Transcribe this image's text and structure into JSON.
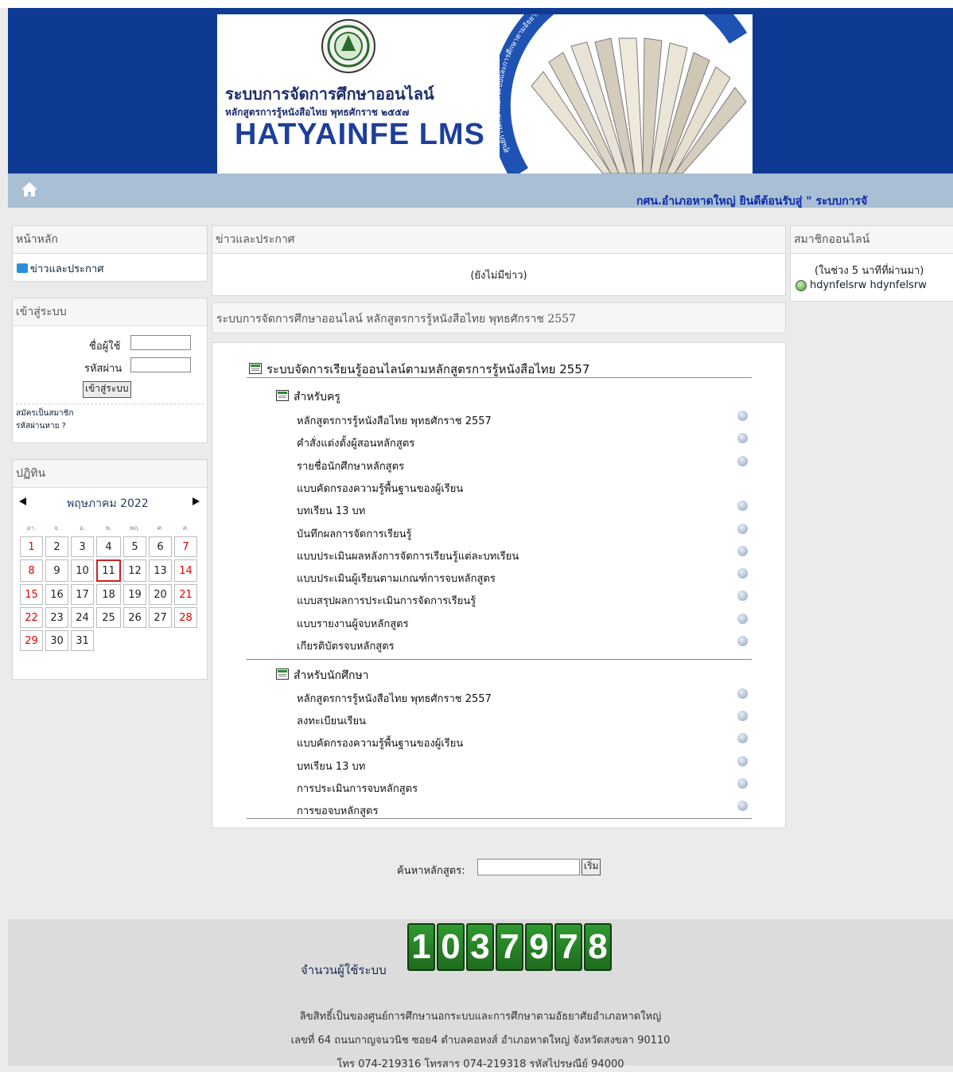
{
  "banner": {
    "title_th": "ระบบการจัดการศึกษาออนไลน์",
    "subtitle_th": "หลักสูตรการรู้หนังสือไทย พุทธศักราช ๒๕๕๗",
    "brand": "HATYAINFE LMS",
    "arc_text": "ศูนย์การศึกษานอกระบบและการศึกษาตามอัธยาศัยอำเภอหาดใหญ่"
  },
  "nav": {
    "marquee": "กศน.อำเภอหาดใหญ่ ยินดีต้อนรับสู่ \" ระบบการจั"
  },
  "left": {
    "main_block": {
      "title": "หน้าหลัก",
      "item": "ข่าวและประกาศ"
    },
    "login_block": {
      "title": "เข้าสู่ระบบ",
      "username_label": "ชื่อผู้ใช้",
      "password_label": "รหัสผ่าน",
      "login_button": "เข้าสู่ระบบ",
      "register_link": "สมัครเป็นสมาชิก",
      "forgot_link": "รหัสผ่านหาย ?"
    },
    "calendar": {
      "title": "ปฏิทิน",
      "month": "พฤษภาคม 2022",
      "weekdays": [
        "อา.",
        "จ.",
        "อ.",
        "พ.",
        "พฤ.",
        "ศ.",
        "ส."
      ],
      "weeks": [
        [
          "1",
          "2",
          "3",
          "4",
          "5",
          "6",
          "7"
        ],
        [
          "8",
          "9",
          "10",
          "11",
          "12",
          "13",
          "14"
        ],
        [
          "15",
          "16",
          "17",
          "18",
          "19",
          "20",
          "21"
        ],
        [
          "22",
          "23",
          "24",
          "25",
          "26",
          "27",
          "28"
        ],
        [
          "29",
          "30",
          "31"
        ]
      ],
      "today": "11",
      "weekend_color": "#e10000"
    }
  },
  "center": {
    "news_title": "ข่าวและประกาศ",
    "news_empty": "(ยังไม่มีข่าว)",
    "site_title": "ระบบการจัดการศึกษาออนไลน์ หลักสูตรการรู้หนังสือไทย พุทธศักราช 2557",
    "root": "ระบบจัดการเรียนรู้ออนไลน์ตามหลักสูตรการรู้หนังสือไทย 2557",
    "teachers": {
      "label": "สำหรับครู",
      "items": [
        "หลักสูตรการรู้หนังสือไทย พุทธศักราช 2557",
        "คำสั่งแต่งตั้งผู้สอนหลักสูตร",
        "รายชื่อนักศึกษาหลักสูตร",
        "แบบคัดกรองความรู้พื้นฐานของผู้เรียน",
        "บทเรียน 13 บท",
        "บันทึกผลการจัดการเรียนรู้",
        "แบบประเมินผลหลังการจัดการเรียนรู้แต่ละบทเรียน",
        "แบบประเมินผู้เรียนตามเกณฑ์การจบหลักสูตร",
        "แบบสรุปผลการประเมินการจัดการเรียนรู้",
        "แบบรายงานผู้จบหลักสูตร",
        "เกียรติบัตรจบหลักสูตร"
      ]
    },
    "students": {
      "label": "สำหรับนักศึกษา",
      "items": [
        "หลักสูตรการรู้หนังสือไทย พุทธศักราช 2557",
        "ลงทะเบียนเรียน",
        "แบบคัดกรองความรู้พื้นฐานของผู้เรียน",
        "บทเรียน 13 บท",
        "การประเมินการจบหลักสูตร",
        "การขอจบหลักสูตร"
      ]
    },
    "search": {
      "label": "ค้นหาหลักสูตร:",
      "value": "",
      "button": "เริ่ม"
    }
  },
  "right": {
    "title": "สมาชิกออนไลน์",
    "period": "(ในช่วง 5 นาทีที่ผ่านมา)",
    "user": "hdynfelsrw hdynfelsrw"
  },
  "footer": {
    "counter_label": "จำนวนผู้ใช้ระบบ",
    "counter_digits": [
      "1",
      "0",
      "3",
      "7",
      "9",
      "7",
      "8"
    ],
    "line1": "ลิขสิทธิ์เป็นของศูนย์การศึกษานอกระบบและการศึกษาตามอัธยาศัยอำเภอหาดใหญ่",
    "line2": "เลขที่ 64 ถนนกาญจนวนิช ซอย4 ตำบลคอหงส์ อำเภอหาดใหญ่ จังหวัดสงขลา 90110",
    "line3": "โทร 074-219316 โทรสาร 074-219318 รหัสไปรษณีย์ 94000"
  },
  "colors": {
    "header": "#0e3a93",
    "navbar": "#a9bfd3",
    "marquee": "#0d2aa8"
  }
}
